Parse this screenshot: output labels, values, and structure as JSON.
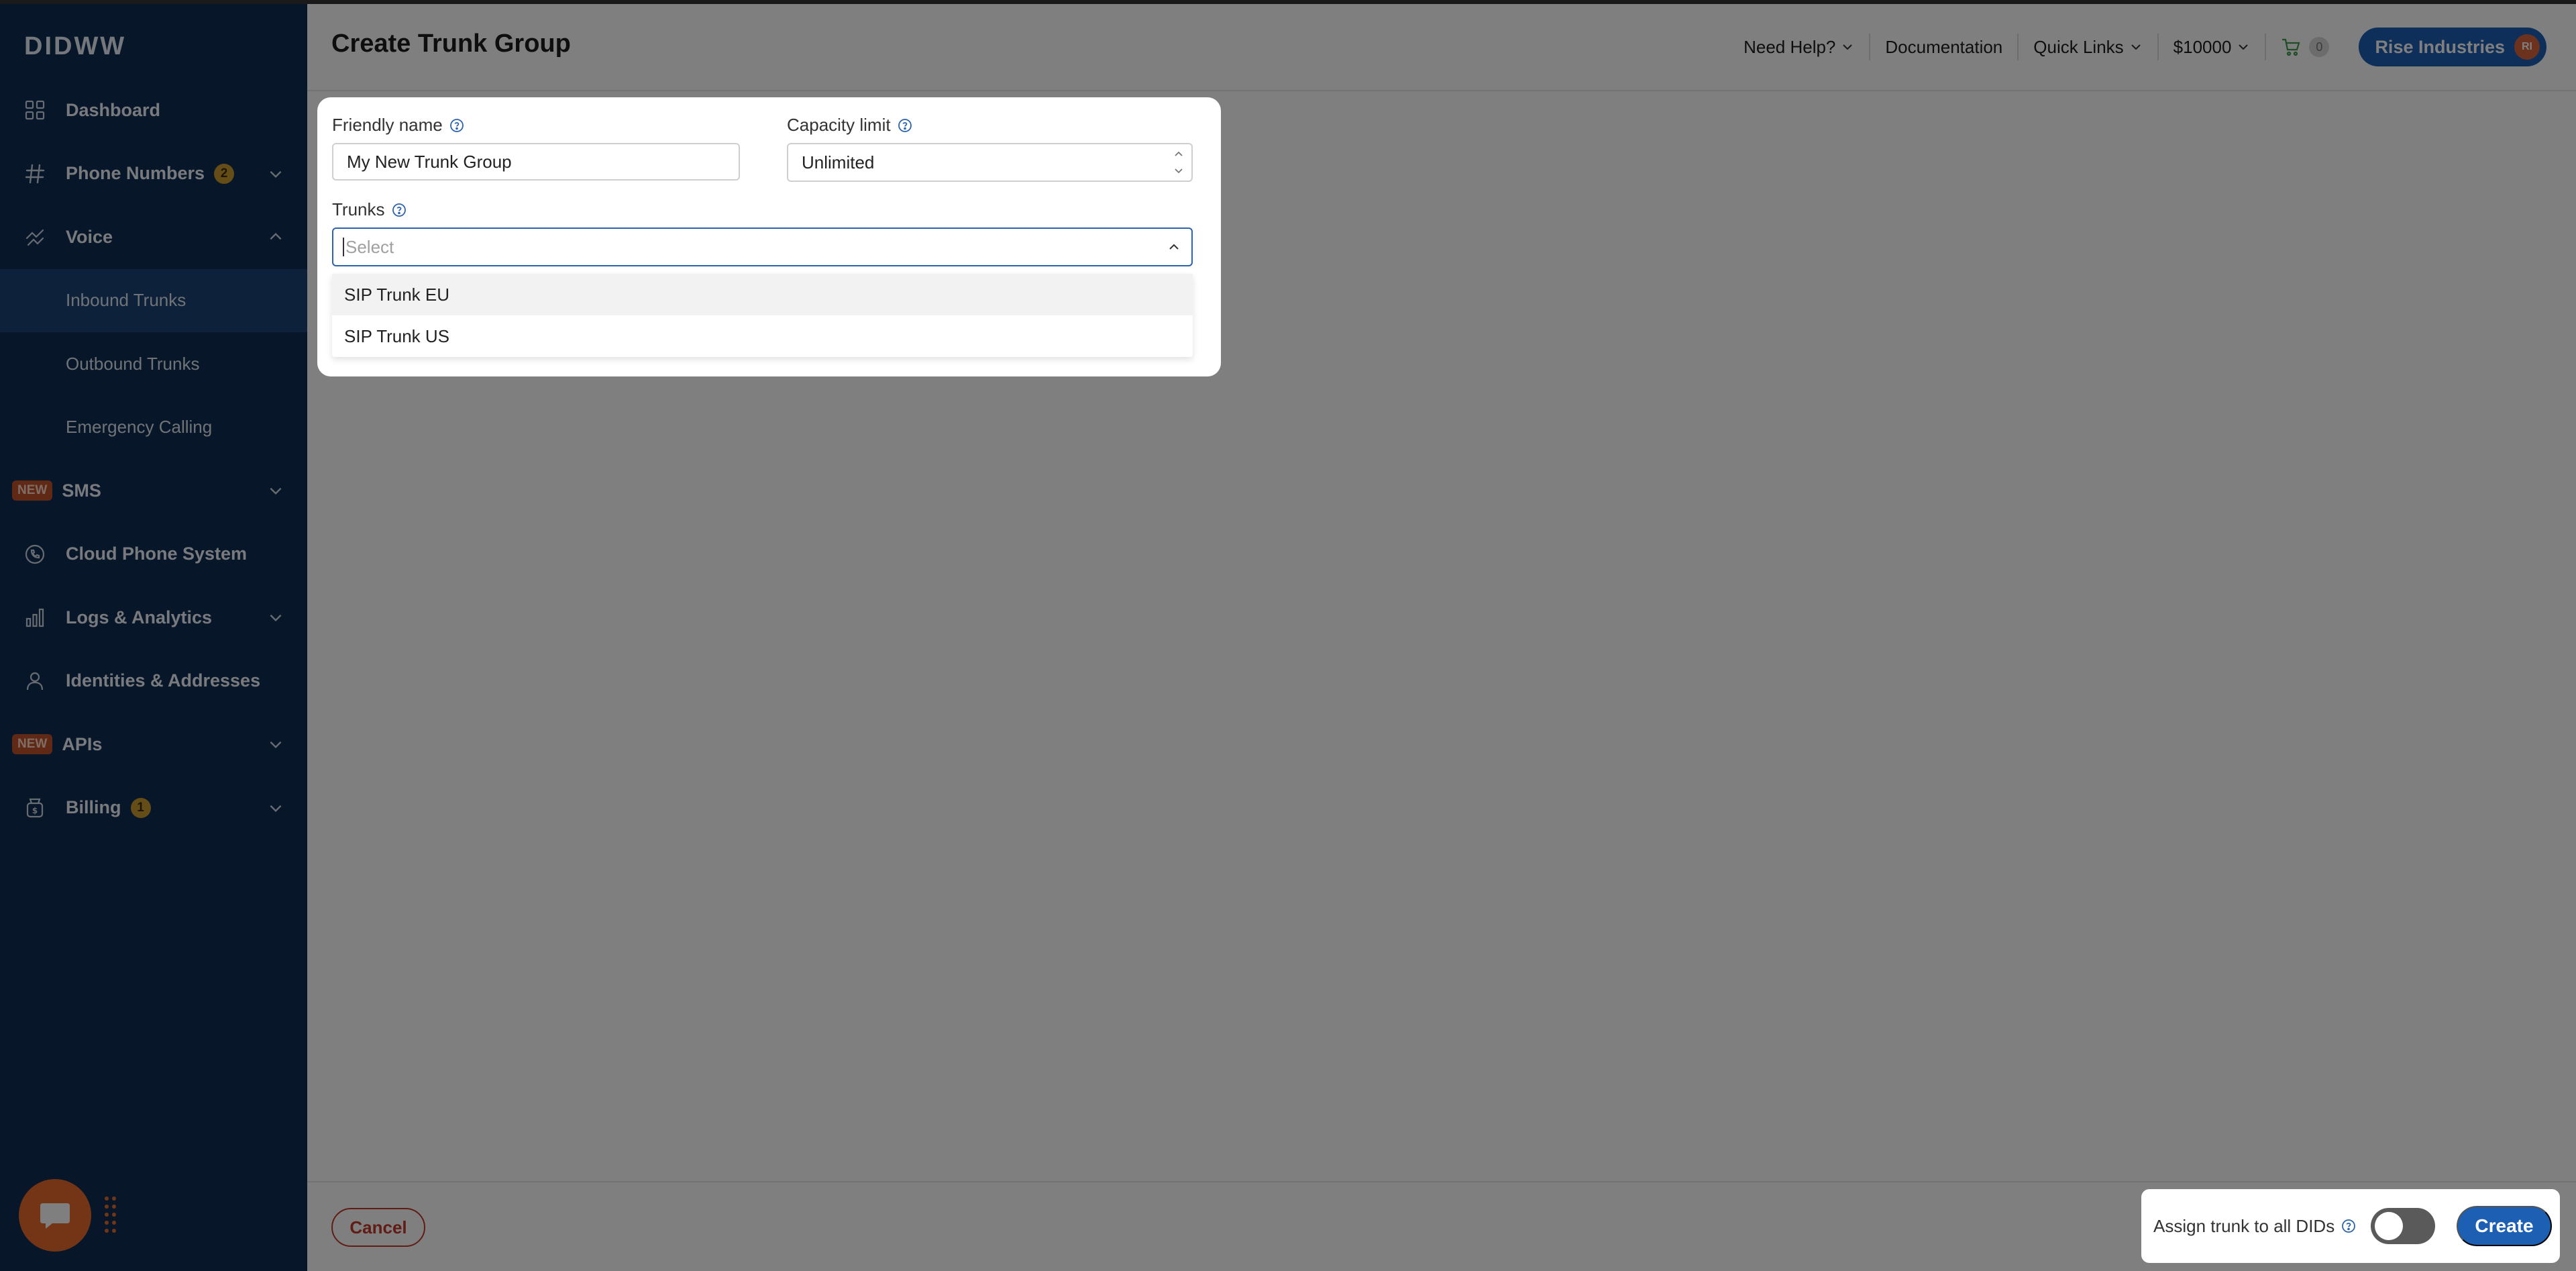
{
  "sidebar": {
    "logo": "DIDWW",
    "items": [
      {
        "label": "Dashboard",
        "icon": "grid-icon"
      },
      {
        "label": "Phone Numbers",
        "icon": "hash-icon",
        "badge": "2"
      },
      {
        "label": "Voice",
        "icon": "voice-icon",
        "expanded": true,
        "subitems": [
          {
            "label": "Inbound Trunks",
            "active": true
          },
          {
            "label": "Outbound Trunks"
          },
          {
            "label": "Emergency Calling"
          }
        ]
      },
      {
        "label": "SMS",
        "tag": "NEW"
      },
      {
        "label": "Cloud Phone System",
        "icon": "phone-circle-icon"
      },
      {
        "label": "Logs & Analytics",
        "icon": "bar-chart-icon"
      },
      {
        "label": "Identities & Addresses",
        "icon": "person-icon"
      },
      {
        "label": "APIs",
        "tag": "NEW"
      },
      {
        "label": "Billing",
        "icon": "money-bag-icon",
        "badge": "1"
      }
    ]
  },
  "header": {
    "title": "Create Trunk Group",
    "need_help": "Need Help?",
    "documentation": "Documentation",
    "quick_links": "Quick Links",
    "balance": "$10000",
    "cart_count": "0",
    "company": "Rise Industries",
    "avatar_initials": "RI"
  },
  "form": {
    "friendly_name_label": "Friendly name",
    "friendly_name_value": "My New Trunk Group",
    "capacity_label": "Capacity limit",
    "capacity_value": "Unlimited",
    "trunks_label": "Trunks",
    "trunks_placeholder": "Select",
    "trunk_options": [
      "SIP Trunk EU",
      "SIP Trunk US"
    ]
  },
  "footer": {
    "cancel": "Cancel",
    "assign_label": "Assign trunk to all DIDs",
    "assign_enabled": false,
    "create": "Create"
  },
  "colors": {
    "sidebar_bg": "#0f2e52",
    "sidebar_active": "#1b4474",
    "primary": "#1c5fb3",
    "badge": "#c99a2e",
    "new_tag": "#c0522d",
    "cancel": "#c0392b",
    "chat": "#e66a2c"
  }
}
